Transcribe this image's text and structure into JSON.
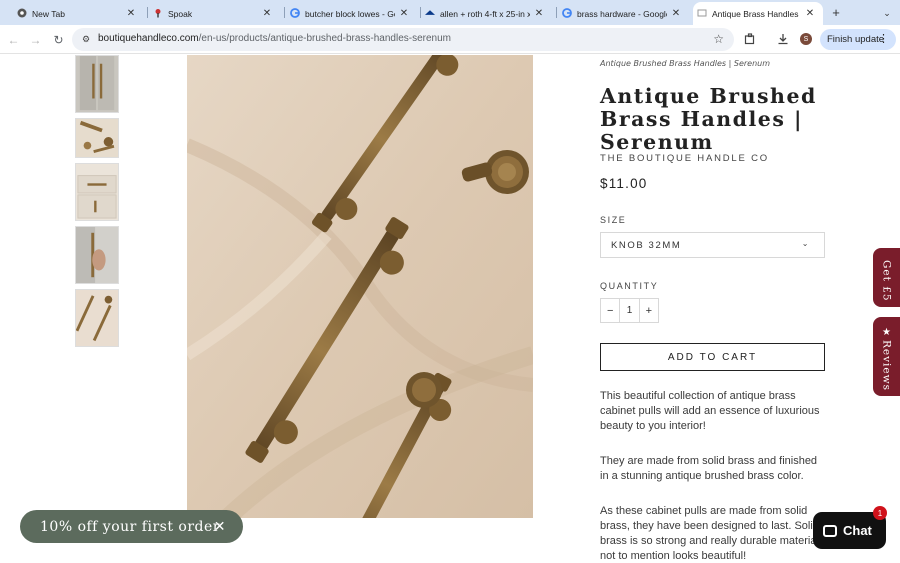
{
  "browser": {
    "tabs": [
      {
        "title": "New Tab",
        "favicon": "chrome-icon"
      },
      {
        "title": "Spoak",
        "favicon": "spoak-icon"
      },
      {
        "title": "butcher block lowes - Go",
        "favicon": "google-icon"
      },
      {
        "title": "allen + roth 4-ft x 25-in x",
        "favicon": "lowes-icon"
      },
      {
        "title": "brass hardware - Google",
        "favicon": "google-icon"
      },
      {
        "title": "Antique Brass Handles | H",
        "favicon": "page-icon",
        "active": true
      }
    ],
    "url_host": "boutiquehandleco.com",
    "url_path": "/en-us/products/antique-brushed-brass-handles-serenum",
    "profile_initial": "S",
    "finish_update_label": "Finish update"
  },
  "product": {
    "breadcrumb": "Antique Brushed Brass Handles | Serenum",
    "title": "Antique Brushed Brass Handles | Serenum",
    "vendor": "THE BOUTIQUE HANDLE CO",
    "price": "$11.00",
    "size_label": "SIZE",
    "size_value": "KNOB 32MM",
    "quantity_label": "QUANTITY",
    "quantity_value": "1",
    "quantity_minus": "−",
    "quantity_plus": "+",
    "add_to_cart": "ADD TO CART",
    "description": [
      "This beautiful collection of antique brass cabinet pulls will add an essence of luxurious beauty to you interior!",
      "They are made from solid brass and finished in a stunning antique brushed brass color.",
      "As these cabinet pulls are made from solid brass, they have been designed to last. Solid brass is so strong and really durable material, not to mention looks beautiful!"
    ]
  },
  "widgets": {
    "get5_label": "Get £5",
    "reviews_label": "Reviews",
    "promo_label": "10% off your first order",
    "chat_label": "Chat",
    "chat_badge": "1"
  },
  "colors": {
    "tab_bar": "#d6e3f5",
    "side_tab": "#7a1d2b",
    "promo": "#5c6b5d",
    "brass": "#8a6a3a"
  }
}
